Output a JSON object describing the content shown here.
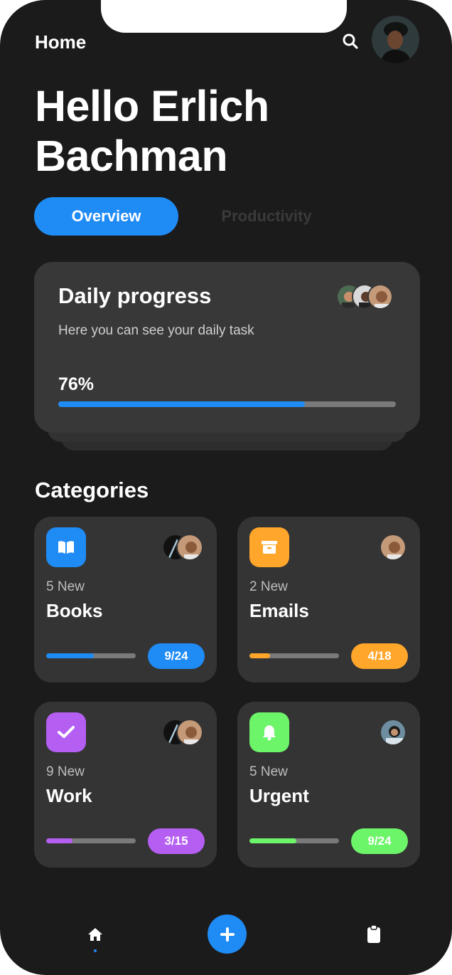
{
  "header": {
    "title": "Home",
    "search_icon": "search-icon",
    "avatar_icon": "user-avatar"
  },
  "greeting": "Hello Erlich Bachman",
  "tabs": [
    {
      "label": "Overview",
      "active": true
    },
    {
      "label": "Productivity",
      "active": false
    }
  ],
  "daily_progress": {
    "title": "Daily progress",
    "subtitle": "Here you can see your daily task",
    "percent_label": "76%",
    "progress_fraction": 0.73,
    "accent": "#1f8bf5"
  },
  "categories_title": "Categories",
  "categories": [
    {
      "new_label": "5 New",
      "name": "Books",
      "badge": "9/24",
      "progress_fraction": 0.53,
      "color": "#1f8bf5",
      "icon": "book-icon"
    },
    {
      "new_label": "2 New",
      "name": "Emails",
      "badge": "4/18",
      "progress_fraction": 0.23,
      "color": "#ffa62b",
      "icon": "archive-icon"
    },
    {
      "new_label": "9 New",
      "name": "Work",
      "badge": "3/15",
      "progress_fraction": 0.29,
      "color": "#b55ff2",
      "icon": "check-icon"
    },
    {
      "new_label": "5 New",
      "name": "Urgent",
      "badge": "9/24",
      "progress_fraction": 0.52,
      "color": "#6df56a",
      "icon": "bell-icon"
    }
  ],
  "bottom_nav": {
    "items": [
      "home-icon",
      "add-icon",
      "clipboard-icon"
    ]
  }
}
